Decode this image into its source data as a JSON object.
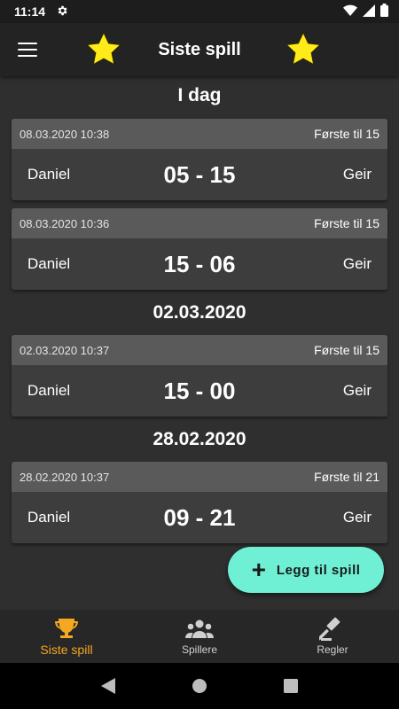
{
  "status_bar": {
    "time": "11:14"
  },
  "app_bar": {
    "title": "Siste spill"
  },
  "sections": [
    {
      "header": "I dag"
    },
    {
      "header": "02.03.2020"
    },
    {
      "header": "28.02.2020"
    }
  ],
  "games": [
    {
      "date": "08.03.2020 10:38",
      "mode": "Første til 15",
      "player1": "Daniel",
      "score": "05 - 15",
      "player2": "Geir"
    },
    {
      "date": "08.03.2020 10:36",
      "mode": "Første til 15",
      "player1": "Daniel",
      "score": "15 - 06",
      "player2": "Geir"
    },
    {
      "date": "02.03.2020 10:37",
      "mode": "Første til 15",
      "player1": "Daniel",
      "score": "15 - 00",
      "player2": "Geir"
    },
    {
      "date": "28.02.2020 10:37",
      "mode": "Første til 21",
      "player1": "Daniel",
      "score": "09 - 21",
      "player2": "Geir"
    }
  ],
  "fab": {
    "label": "Legg til spill"
  },
  "bottom_nav": [
    {
      "label": "Siste spill",
      "icon": "trophy-icon",
      "active": true
    },
    {
      "label": "Spillere",
      "icon": "people-icon",
      "active": false
    },
    {
      "label": "Regler",
      "icon": "gavel-icon",
      "active": false
    }
  ],
  "colors": {
    "background": "#2f2f2f",
    "app_bar": "#232323",
    "card": "#3d3d3d",
    "card_header": "#5a5a5a",
    "star": "#ffeb1a",
    "fab": "#6ff0d4",
    "active_nav": "#f5a623"
  }
}
